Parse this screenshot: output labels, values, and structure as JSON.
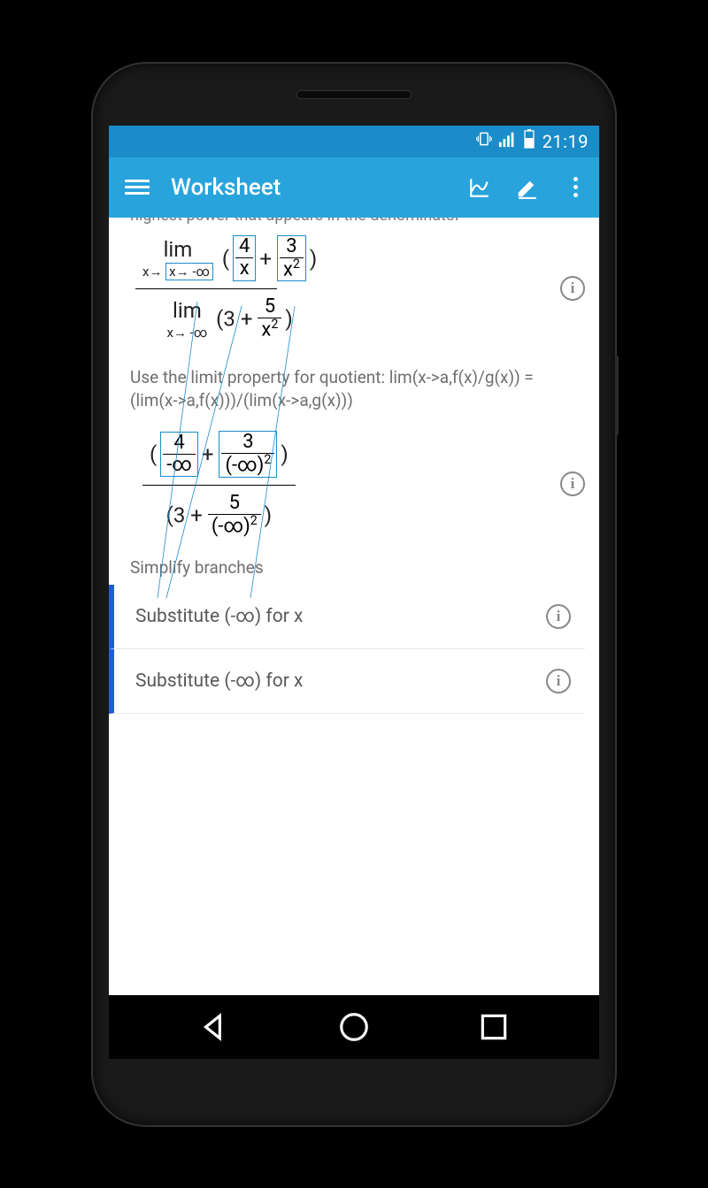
{
  "status": {
    "time": "21:19"
  },
  "appbar": {
    "title": "Worksheet"
  },
  "content": {
    "cutoff": "highest power that appears in the denominator",
    "step1": {
      "num": {
        "lim": "lim",
        "sub": "x→ -∞",
        "f1n": "4",
        "f1d": "x",
        "f2n": "3",
        "f2d_base": "x",
        "f2d_exp": "2"
      },
      "den": {
        "lim": "lim",
        "sub": "x→ -∞",
        "const": "3",
        "fn": "5",
        "fd_base": "x",
        "fd_exp": "2"
      }
    },
    "desc1": "Use the limit property for quotient:  lim(x->a,f(x)/g(x)) = (lim(x->a,f(x)))/(lim(x->a,g(x)))",
    "step2": {
      "num": {
        "f1n": "4",
        "f1d": "-∞",
        "f2n": "3",
        "f2d_base": "(-∞)",
        "f2d_exp": "2"
      },
      "den": {
        "const": "3",
        "fn": "5",
        "fd_base": "(-∞)",
        "fd_exp": "2"
      }
    },
    "simplify": "Simplify  branches",
    "substeps": [
      {
        "text": "Substitute (-∞)  for  x"
      },
      {
        "text": "Substitute (-∞)  for  x"
      }
    ]
  }
}
